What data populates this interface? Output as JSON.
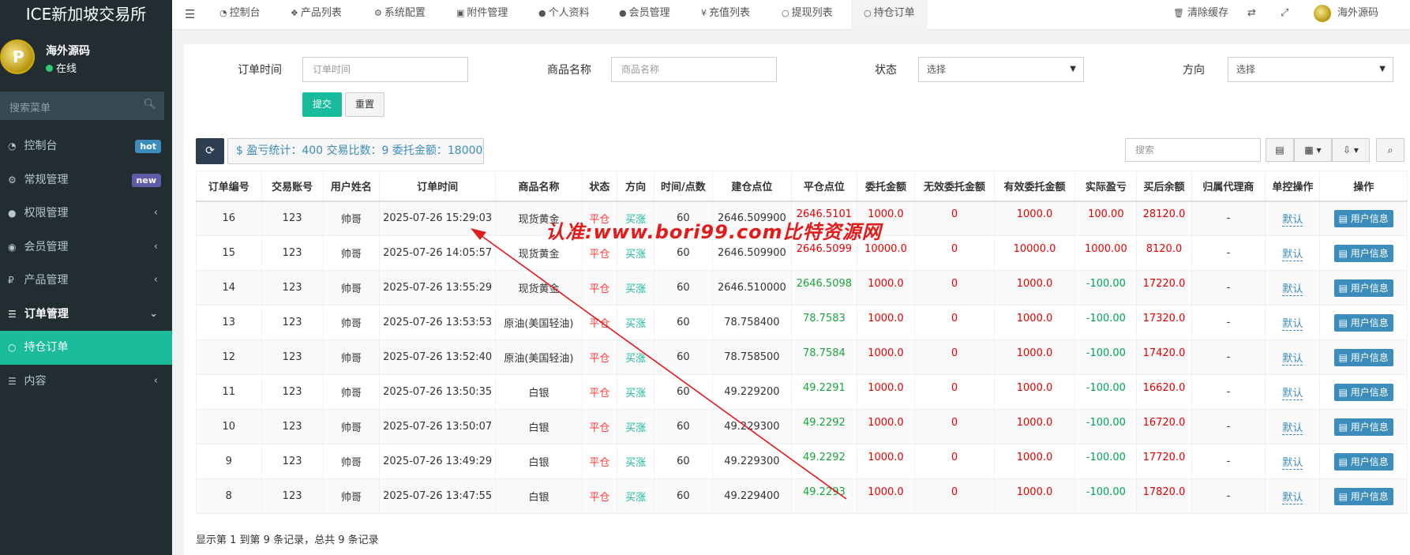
{
  "app": {
    "title": "ICE新加坡交易所"
  },
  "user": {
    "name": "海外源码",
    "status": "在线"
  },
  "sidebar": {
    "search_placeholder": "搜索菜单",
    "items": [
      {
        "label": "控制台",
        "badge": "hot"
      },
      {
        "label": "常规管理",
        "badge": "new"
      },
      {
        "label": "权限管理",
        "chevron": "‹"
      },
      {
        "label": "会员管理",
        "chevron": "‹"
      },
      {
        "label": "产品管理",
        "chevron": "‹"
      },
      {
        "label": "订单管理",
        "chevron": "⌄"
      },
      {
        "label": "持仓订单"
      },
      {
        "label": "内容",
        "chevron": "‹"
      }
    ]
  },
  "topnav": {
    "tabs": [
      "控制台",
      "产品列表",
      "系统配置",
      "附件管理",
      "个人资料",
      "会员管理",
      "充值列表",
      "提现列表",
      "持仓订单"
    ],
    "clear_cache": "清除缓存",
    "user_name": "海外源码"
  },
  "filters": {
    "order_time_label": "订单时间",
    "order_time_placeholder": "订单时间",
    "product_label": "商品名称",
    "product_placeholder": "商品名称",
    "status_label": "状态",
    "status_value": "选择",
    "direction_label": "方向",
    "direction_value": "选择",
    "submit": "提交",
    "reset": "重置"
  },
  "toolbar": {
    "stats": "$ 盈亏统计：400 交易比数：9 委托金额：18000",
    "search_placeholder": "搜索"
  },
  "table": {
    "headers": [
      "订单编号",
      "交易账号",
      "用户姓名",
      "订单时间",
      "商品名称",
      "状态",
      "方向",
      "时间/点数",
      "建仓点位",
      "平仓点位",
      "委托金额",
      "无效委托金额",
      "有效委托金额",
      "实际盈亏",
      "买后余额",
      "归属代理商",
      "单控操作",
      "操作"
    ],
    "rows": [
      [
        "16",
        "123",
        "帅哥",
        "2025-07-26 15:29:03",
        "现货黄金",
        "平仓",
        "买涨",
        "60",
        "2646.509900",
        "2646.5101",
        "1000.0",
        "0",
        "1000.0",
        "100.00",
        "28120.0",
        "-",
        "默认",
        "用户信息"
      ],
      [
        "15",
        "123",
        "帅哥",
        "2025-07-26 14:05:57",
        "现货黄金",
        "平仓",
        "买涨",
        "60",
        "2646.509900",
        "2646.5099",
        "10000.0",
        "0",
        "10000.0",
        "1000.00",
        "8120.0",
        "-",
        "默认",
        "用户信息"
      ],
      [
        "14",
        "123",
        "帅哥",
        "2025-07-26 13:55:29",
        "现货黄金",
        "平仓",
        "买涨",
        "60",
        "2646.510000",
        "2646.5098",
        "1000.0",
        "0",
        "1000.0",
        "-100.00",
        "17220.0",
        "-",
        "默认",
        "用户信息"
      ],
      [
        "13",
        "123",
        "帅哥",
        "2025-07-26 13:53:53",
        "原油(美国轻油)",
        "平仓",
        "买涨",
        "60",
        "78.758400",
        "78.7583",
        "1000.0",
        "0",
        "1000.0",
        "-100.00",
        "17320.0",
        "-",
        "默认",
        "用户信息"
      ],
      [
        "12",
        "123",
        "帅哥",
        "2025-07-26 13:52:40",
        "原油(美国轻油)",
        "平仓",
        "买涨",
        "60",
        "78.758500",
        "78.7584",
        "1000.0",
        "0",
        "1000.0",
        "-100.00",
        "17420.0",
        "-",
        "默认",
        "用户信息"
      ],
      [
        "11",
        "123",
        "帅哥",
        "2025-07-26 13:50:35",
        "白银",
        "平仓",
        "买涨",
        "60",
        "49.229200",
        "49.2291",
        "1000.0",
        "0",
        "1000.0",
        "-100.00",
        "16620.0",
        "-",
        "默认",
        "用户信息"
      ],
      [
        "10",
        "123",
        "帅哥",
        "2025-07-26 13:50:07",
        "白银",
        "平仓",
        "买涨",
        "60",
        "49.229300",
        "49.2292",
        "1000.0",
        "0",
        "1000.0",
        "-100.00",
        "16720.0",
        "-",
        "默认",
        "用户信息"
      ],
      [
        "9",
        "123",
        "帅哥",
        "2025-07-26 13:49:29",
        "白银",
        "平仓",
        "买涨",
        "60",
        "49.229300",
        "49.2292",
        "1000.0",
        "0",
        "1000.0",
        "-100.00",
        "17720.0",
        "-",
        "默认",
        "用户信息"
      ],
      [
        "8",
        "123",
        "帅哥",
        "2025-07-26 13:47:55",
        "白银",
        "平仓",
        "买涨",
        "60",
        "49.229400",
        "49.2293",
        "1000.0",
        "0",
        "1000.0",
        "-100.00",
        "17820.0",
        "-",
        "默认",
        "用户信息"
      ]
    ]
  },
  "pagination": {
    "summary": "显示第 1 到第 9 条记录，总共 9 条记录"
  },
  "watermark": "认准:www.bori99.com比特资源网",
  "colors": {
    "accent": "#18bc9c",
    "sidebar": "#222d32",
    "primary": "#3c8dbc",
    "loss": "#e60000",
    "profit": "#18a53c"
  }
}
